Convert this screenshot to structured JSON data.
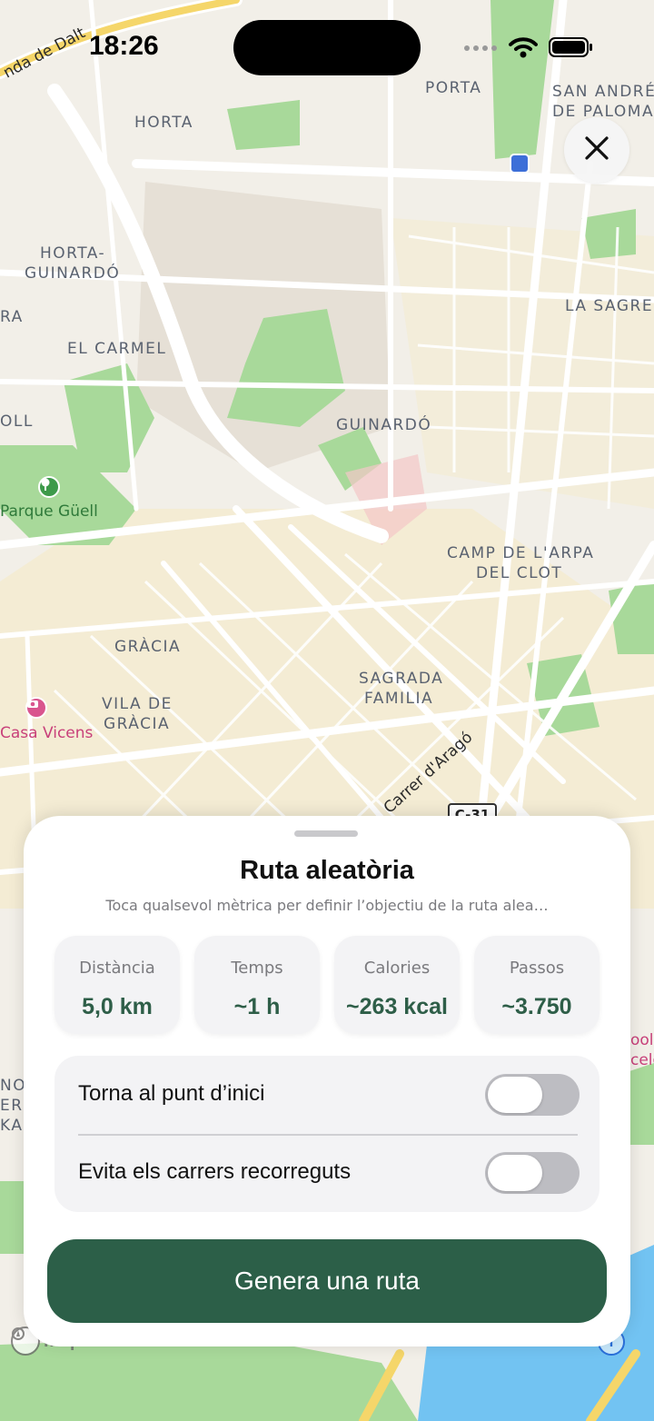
{
  "status_bar": {
    "time": "18:26",
    "icons": [
      "cellular-signal-icon",
      "wifi-icon",
      "battery-icon"
    ]
  },
  "map": {
    "areas": {
      "porta": "PORTA",
      "sant_andreu_1": "SAN ANDRÉS",
      "sant_andreu_2": "DE PALOMAR",
      "horta": "HORTA",
      "horta_guinardo_1": "HORTA-",
      "horta_guinardo_2": "GUINARDÓ",
      "la_sagrera": "LA SAGRER",
      "el_carmel": "EL CARMEL",
      "guinardo": "GUINARDÓ",
      "camp_arpa_1": "CAMP DE L'ARPA",
      "camp_arpa_2": "DEL CLOT",
      "gracia": "GRÀCIA",
      "sagrada_familia_1": "SAGRADA",
      "sagrada_familia_2": "FAMILIA",
      "vila_gracia_1": "VILA DE",
      "vila_gracia_2": "GRÀCIA",
      "left_ra": "RA",
      "left_oll": "OLL",
      "left_nov": "NOV",
      "left_er": "ER",
      "left_kam": "KAM",
      "right_ool": "ool",
      "right_celo": "celo"
    },
    "pois": {
      "parque_guell": "Parque Güell",
      "casa_vicens": "Casa Vicens"
    },
    "streets": {
      "ronda_dalt": "nda de Dalt",
      "carrer_arago": "Carrer d'Aragó"
    },
    "road_shield": "C-31",
    "attribution": "mapbox",
    "info_label": "i",
    "colors": {
      "land": "#f2efe8",
      "park": "#a6d89a",
      "road": "#ffffff",
      "water": "#6fc0f0",
      "urban": "#f3ebd2"
    }
  },
  "close_button": {
    "icon": "close-icon"
  },
  "sheet": {
    "title": "Ruta aleatòria",
    "subtitle": "Toca qualsevol mètrica per definir l’objectiu de la ruta alea…",
    "metrics": [
      {
        "label": "Distància",
        "value": "5,0 km"
      },
      {
        "label": "Temps",
        "value": "~1 h"
      },
      {
        "label": "Calories",
        "value": "~263 kcal"
      },
      {
        "label": "Passos",
        "value": "~3.750"
      }
    ],
    "options": [
      {
        "label": "Torna al punt d’inici",
        "enabled": false
      },
      {
        "label": "Evita els carrers recorreguts",
        "enabled": false
      }
    ],
    "primary_button": "Genera una ruta",
    "accent_color": "#2c5f48"
  }
}
